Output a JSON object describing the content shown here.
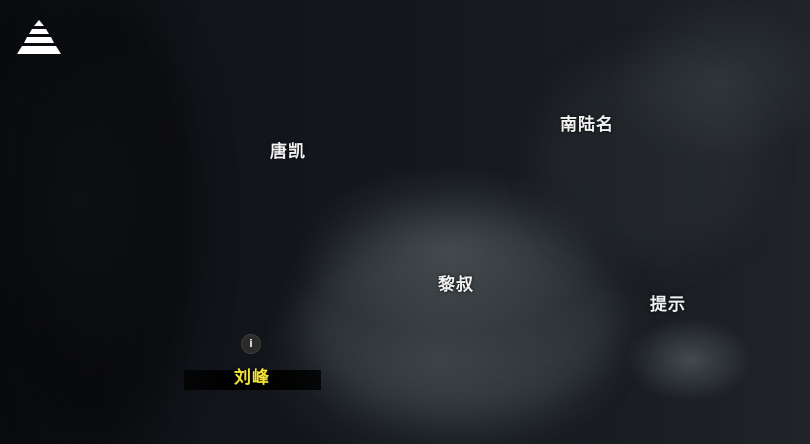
{
  "menu": {
    "icon": "pyramid-menu-icon",
    "color": "#ffffff"
  },
  "characters": [
    {
      "name": "唐凯"
    },
    {
      "name": "南陆名"
    },
    {
      "name": "黎叔"
    },
    {
      "name": "提示"
    }
  ],
  "player": {
    "name": "刘峰",
    "marker": "i",
    "name_color": "#f4e43a"
  }
}
